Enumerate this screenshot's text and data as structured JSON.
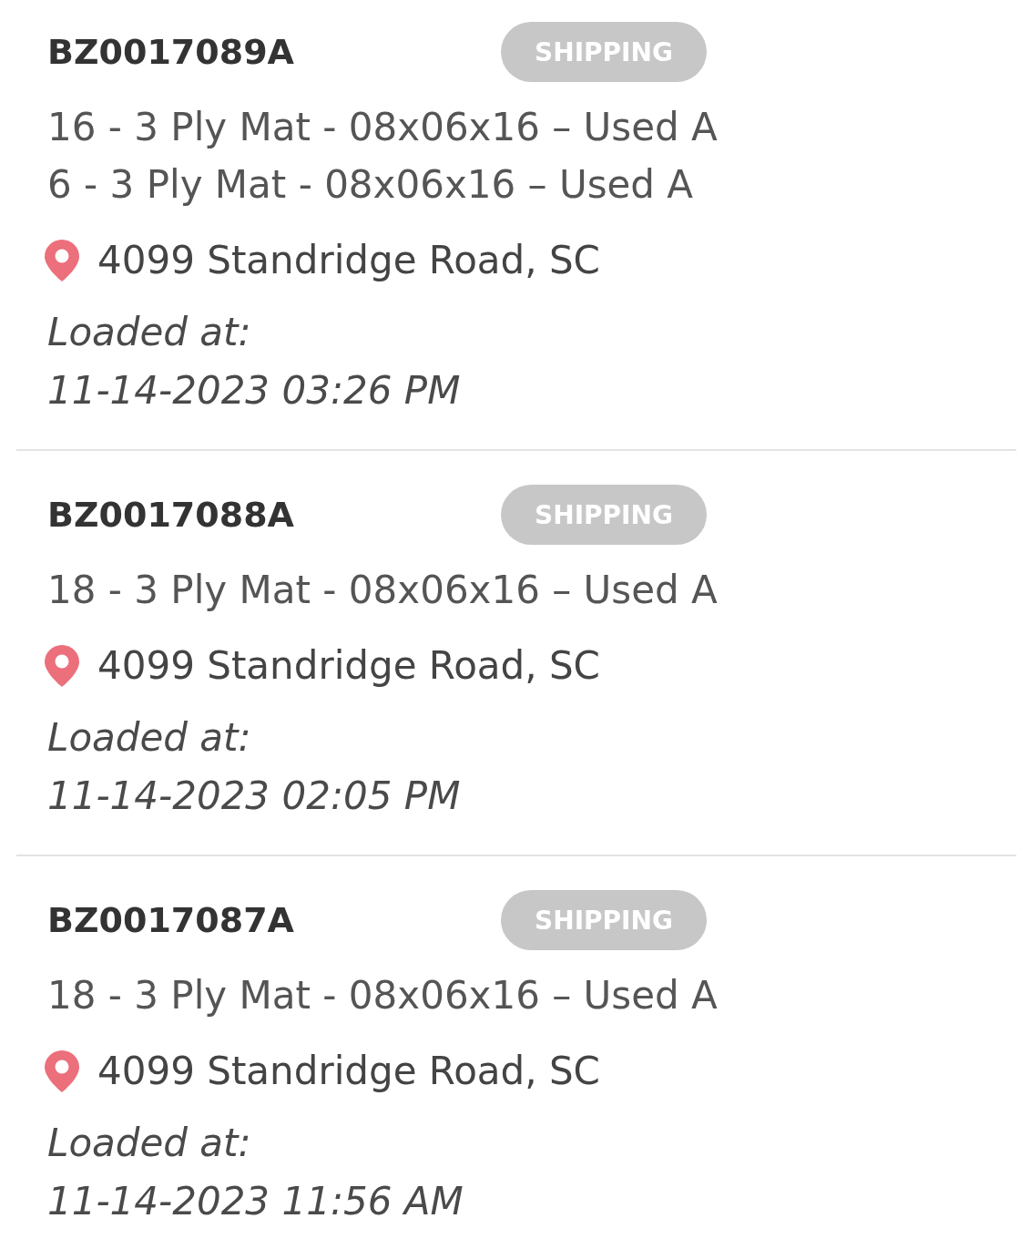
{
  "shipments": [
    {
      "order_id": "BZ0017089A",
      "status": "SHIPPING",
      "items": [
        "16 - 3 Ply Mat - 08x06x16 – Used A",
        "6 - 3 Ply Mat - 08x06x16 – Used A"
      ],
      "address": "4099 Standridge Road, SC",
      "loaded_label": "Loaded at:",
      "loaded_time": "11-14-2023 03:26 PM"
    },
    {
      "order_id": "BZ0017088A",
      "status": "SHIPPING",
      "items": [
        "18 - 3 Ply Mat - 08x06x16 – Used A"
      ],
      "address": "4099 Standridge Road, SC",
      "loaded_label": "Loaded at:",
      "loaded_time": "11-14-2023 02:05 PM"
    },
    {
      "order_id": "BZ0017087A",
      "status": "SHIPPING",
      "items": [
        "18 - 3 Ply Mat - 08x06x16 – Used A"
      ],
      "address": "4099 Standridge Road, SC",
      "loaded_label": "Loaded at:",
      "loaded_time": "11-14-2023 11:56 AM"
    }
  ]
}
